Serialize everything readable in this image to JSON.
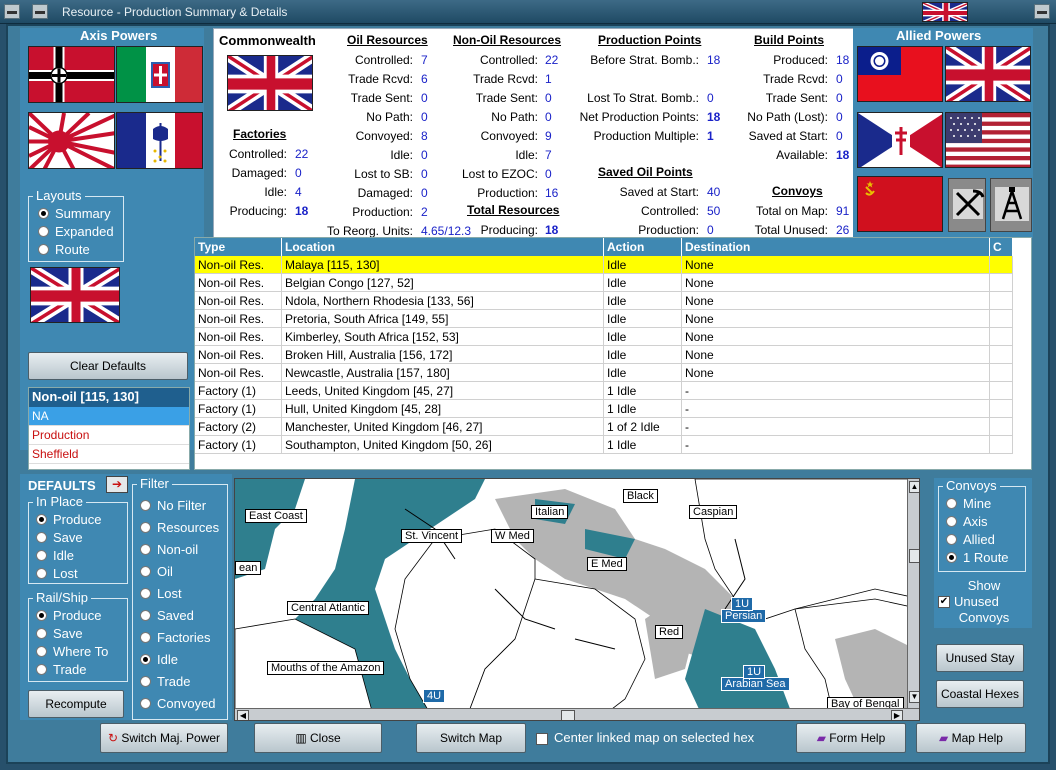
{
  "window": {
    "title": "Resource - Production Summary & Details"
  },
  "axis": {
    "header": "Axis Powers"
  },
  "allied": {
    "header": "Allied Powers"
  },
  "layouts": {
    "legend": "Layouts",
    "options": [
      "Summary",
      "Expanded",
      "Route"
    ],
    "selected": 0
  },
  "buttons": {
    "clear_defaults": "Clear Defaults",
    "recompute": "Recompute",
    "switch_power": "Switch Maj. Power",
    "close": "Close",
    "switch_map": "Switch Map",
    "form_help": "Form Help",
    "map_help": "Map Help",
    "unused_stay": "Unused Stay",
    "coastal_hexes": "Coastal Hexes"
  },
  "info": {
    "title": "Non-oil [115, 130]",
    "lines": [
      "NA",
      "Production",
      "Sheffield"
    ]
  },
  "defaults": {
    "label": "DEFAULTS",
    "in_place": {
      "legend": "In Place",
      "options": [
        "Produce",
        "Save",
        "Idle",
        "Lost"
      ],
      "selected": 0
    },
    "rail_ship": {
      "legend": "Rail/Ship",
      "options": [
        "Produce",
        "Save",
        "Where To",
        "Trade"
      ],
      "selected": 0
    }
  },
  "filter": {
    "legend": "Filter",
    "options": [
      "No Filter",
      "Resources",
      "Non-oil",
      "Oil",
      "Lost",
      "Saved",
      "Factories",
      "Idle",
      "Trade",
      "Convoyed"
    ],
    "selected": 7
  },
  "convoys_box": {
    "legend": "Convoys",
    "options": [
      "Mine",
      "Axis",
      "Allied",
      "1 Route"
    ],
    "selected": 3,
    "show_unused_line1": "Show",
    "show_unused_line2": "Unused",
    "show_unused_line3": "Convoys",
    "show_unused_checked": "✔"
  },
  "center_linked": {
    "label": "Center linked map on selected hex",
    "checked": ""
  },
  "summary": {
    "nation": "Commonwealth",
    "factories": {
      "title": "Factories",
      "rows": [
        [
          "Controlled:",
          "22"
        ],
        [
          "Damaged:",
          "0"
        ],
        [
          "Idle:",
          "4"
        ],
        [
          "Producing:",
          "18"
        ]
      ]
    },
    "oil": {
      "title": "Oil Resources",
      "rows": [
        [
          "Controlled:",
          "7"
        ],
        [
          "Trade Rcvd:",
          "6"
        ],
        [
          "Trade Sent:",
          "0"
        ],
        [
          "No Path:",
          "0"
        ],
        [
          "Convoyed:",
          "8"
        ],
        [
          "Idle:",
          "0"
        ],
        [
          "Lost to SB:",
          "0"
        ],
        [
          "Damaged:",
          "0"
        ],
        [
          "Production:",
          "2"
        ],
        [
          "To Reorg. Units:",
          "4.65/12.3"
        ]
      ]
    },
    "nonoil": {
      "title": "Non-Oil Resources",
      "rows": [
        [
          "Controlled:",
          "22"
        ],
        [
          "Trade Rcvd:",
          "1"
        ],
        [
          "Trade Sent:",
          "0"
        ],
        [
          "No Path:",
          "0"
        ],
        [
          "Convoyed:",
          "9"
        ],
        [
          "Idle:",
          "7"
        ],
        [
          "Lost to EZOC:",
          "0"
        ],
        [
          "Production:",
          "16"
        ]
      ]
    },
    "total": {
      "title": "Total Resources",
      "rows": [
        [
          "Producing:",
          "18"
        ]
      ]
    },
    "prod": {
      "title": "Production Points",
      "rows": [
        [
          "Before Strat. Bomb.:",
          "18"
        ],
        [
          "Lost To Strat. Bomb.:",
          "0"
        ],
        [
          "Net Production Points:",
          "18"
        ],
        [
          "Production Multiple:",
          "1"
        ]
      ]
    },
    "saved_oil": {
      "title": "Saved Oil Points",
      "rows": [
        [
          "Saved at Start:",
          "40"
        ],
        [
          "Controlled:",
          "50"
        ],
        [
          "Production:",
          "0"
        ]
      ]
    },
    "build": {
      "title": "Build Points",
      "rows": [
        [
          "Produced:",
          "18"
        ],
        [
          "Trade Rcvd:",
          "0"
        ],
        [
          "Trade Sent:",
          "0"
        ],
        [
          "No Path (Lost):",
          "0"
        ],
        [
          "Saved at Start:",
          "0"
        ],
        [
          "Available:",
          "18"
        ]
      ]
    },
    "convoys": {
      "title": "Convoys",
      "rows": [
        [
          "Total on Map:",
          "91"
        ],
        [
          "Total Unused:",
          "26"
        ]
      ]
    }
  },
  "table": {
    "headers": [
      "Type",
      "Location",
      "Action",
      "Destination",
      "C"
    ],
    "rows": [
      [
        "Non-oil Res.",
        "Malaya [115, 130]",
        "Idle",
        "None"
      ],
      [
        "Non-oil Res.",
        "Belgian Congo [127, 52]",
        "Idle",
        "None"
      ],
      [
        "Non-oil Res.",
        "Ndola, Northern Rhodesia [133, 56]",
        "Idle",
        "None"
      ],
      [
        "Non-oil Res.",
        "Pretoria, South Africa [149, 55]",
        "Idle",
        "None"
      ],
      [
        "Non-oil Res.",
        "Kimberley, South Africa [152, 53]",
        "Idle",
        "None"
      ],
      [
        "Non-oil Res.",
        "Broken Hill, Australia [156, 172]",
        "Idle",
        "None"
      ],
      [
        "Non-oil Res.",
        "Newcastle, Australia [157, 180]",
        "Idle",
        "None"
      ],
      [
        "Factory (1)",
        "Leeds, United Kingdom [45, 27]",
        "1 Idle",
        "-"
      ],
      [
        "Factory (1)",
        "Hull, United Kingdom [45, 28]",
        "1 Idle",
        "-"
      ],
      [
        "Factory (2)",
        "Manchester, United Kingdom [46, 27]",
        "1 of 2 Idle",
        "-"
      ],
      [
        "Factory (1)",
        "Southampton, United Kingdom [50, 26]",
        "1 Idle",
        "-"
      ]
    ],
    "selected": 0
  },
  "map": {
    "labels": [
      "East Coast",
      "Italian",
      "Black",
      "Caspian",
      "St. Vincent",
      "W Med",
      "E Med",
      "Central Atlantic",
      "Red",
      "Mouths of the Amazon",
      "Bay of Bengal",
      "ean"
    ],
    "blue_labels": [
      "Persian",
      "Arabian Sea",
      "1U",
      "1U",
      "4U"
    ]
  },
  "colors": {
    "sea": "#2f7f8e",
    "land_white": "#ffffff",
    "land_grey": "#b4b4b4",
    "selected_row": "#ffff00",
    "panel": "#3f88b2"
  }
}
